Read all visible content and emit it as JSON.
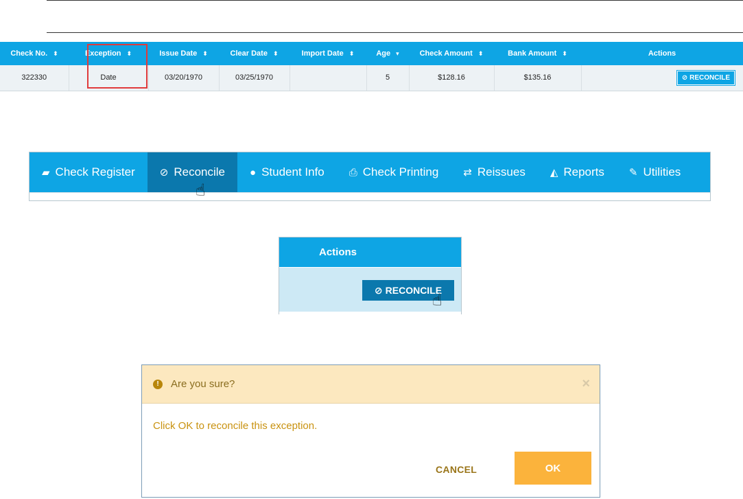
{
  "table": {
    "headers": [
      "Check No.",
      "Exception",
      "Issue Date",
      "Clear Date",
      "Import Date",
      "Age",
      "Check Amount",
      "Bank Amount",
      "Actions"
    ],
    "sort_icons": [
      "sort-icon",
      "sort-icon",
      "sort-icon",
      "sort-icon",
      "sort-icon",
      "sort-desc-icon",
      "sort-icon",
      "sort-icon"
    ],
    "rows": [
      {
        "check_no": "322330",
        "exception": "Date",
        "issue_date": "03/20/1970",
        "clear_date": "03/25/1970",
        "import_date": "",
        "age": "5",
        "check_amount": "$128.16",
        "bank_amount": "$135.16",
        "action_label": "RECONCILE"
      }
    ]
  },
  "nav": {
    "items": [
      {
        "label": "Check Register",
        "icon": "book-icon"
      },
      {
        "label": "Reconcile",
        "icon": "circle-check-icon"
      },
      {
        "label": "Student Info",
        "icon": "user-icon"
      },
      {
        "label": "Check Printing",
        "icon": "printer-icon"
      },
      {
        "label": "Reissues",
        "icon": "refresh-icon"
      },
      {
        "label": "Reports",
        "icon": "area-chart-icon"
      },
      {
        "label": "Utilities",
        "icon": "wrench-icon"
      }
    ],
    "active": "Reconcile"
  },
  "zoom": {
    "header": "Actions",
    "button_label": "RECONCILE"
  },
  "dialog": {
    "title": "Are you sure?",
    "message": "Click OK to reconcile this exception.",
    "cancel_label": "CANCEL",
    "ok_label": "OK"
  },
  "colors": {
    "primary": "#0ea5e4",
    "primary_dark": "#0b78ad",
    "warning_bg": "#fce8bf",
    "ok_button": "#fbb33c",
    "highlight": "#e03a3a"
  }
}
